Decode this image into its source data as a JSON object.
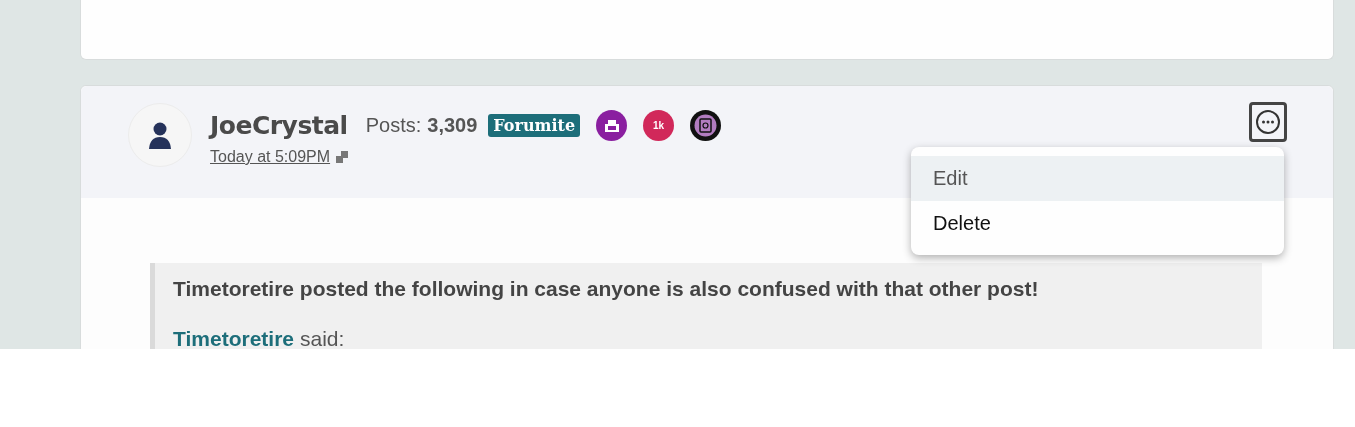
{
  "post": {
    "author": "JoeCrystal",
    "posts_label": "Posts:",
    "posts_count": "3,309",
    "rank": "Forumite",
    "badge_count": "1k",
    "time": "Today at 5:09PM"
  },
  "menu": {
    "items": [
      {
        "label": "Edit",
        "selected": true
      },
      {
        "label": "Delete",
        "selected": false
      }
    ]
  },
  "quote": {
    "intro": "Timetoretire posted the following in case anyone is also confused with that other post!",
    "source": "Timetoretire",
    "said": "said:"
  }
}
